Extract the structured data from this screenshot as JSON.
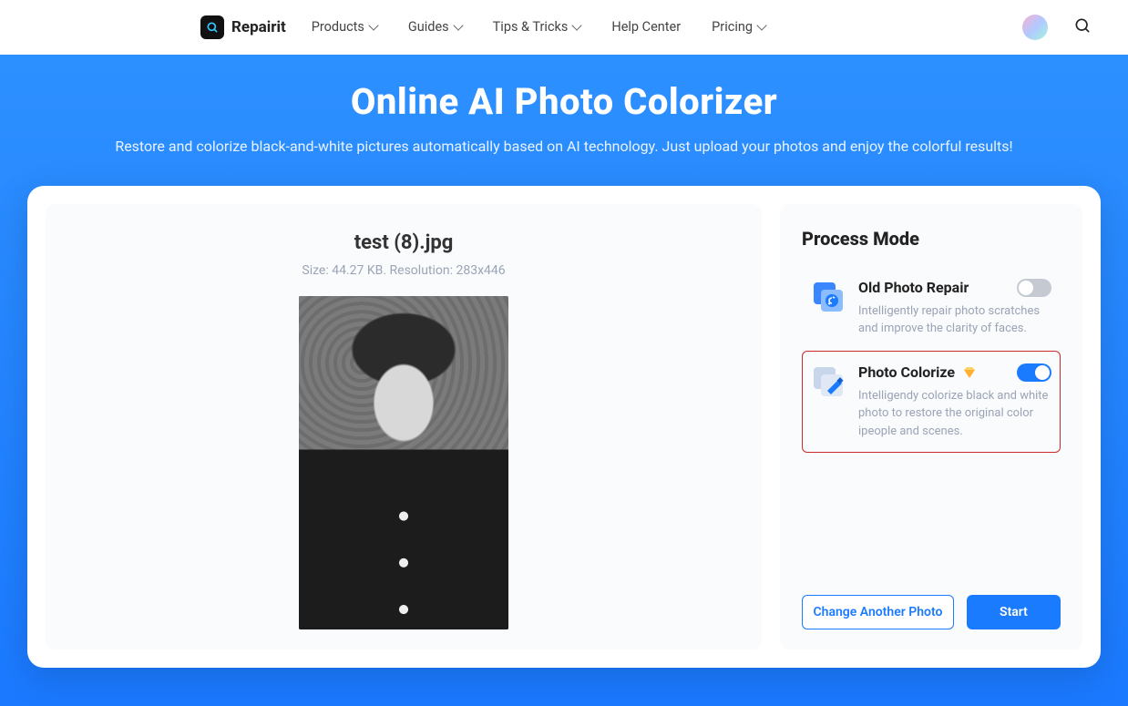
{
  "brand": {
    "name": "Repairit"
  },
  "nav": {
    "items": [
      {
        "label": "Products",
        "dropdown": true
      },
      {
        "label": "Guides",
        "dropdown": true
      },
      {
        "label": "Tips & Tricks",
        "dropdown": true
      },
      {
        "label": "Help Center",
        "dropdown": false
      },
      {
        "label": "Pricing",
        "dropdown": true
      }
    ]
  },
  "hero": {
    "title": "Online AI Photo Colorizer",
    "subtitle": "Restore and colorize black-and-white pictures automatically based on AI technology. Just upload your photos and enjoy the colorful results!"
  },
  "file": {
    "name": "test (8).jpg",
    "meta": "Size: 44.27 KB. Resolution: 283x446"
  },
  "panel": {
    "title": "Process Mode",
    "modes": [
      {
        "name": "Old Photo Repair",
        "desc": "Intelligently repair photo scratches and improve the clarity of faces.",
        "enabled": false,
        "premium": false
      },
      {
        "name": "Photo Colorize",
        "desc": "Intelligendy colorize black and white photo to restore the original color ipeople and scenes.",
        "enabled": true,
        "premium": true
      }
    ],
    "actions": {
      "change": "Change Another Photo",
      "start": "Start"
    }
  }
}
